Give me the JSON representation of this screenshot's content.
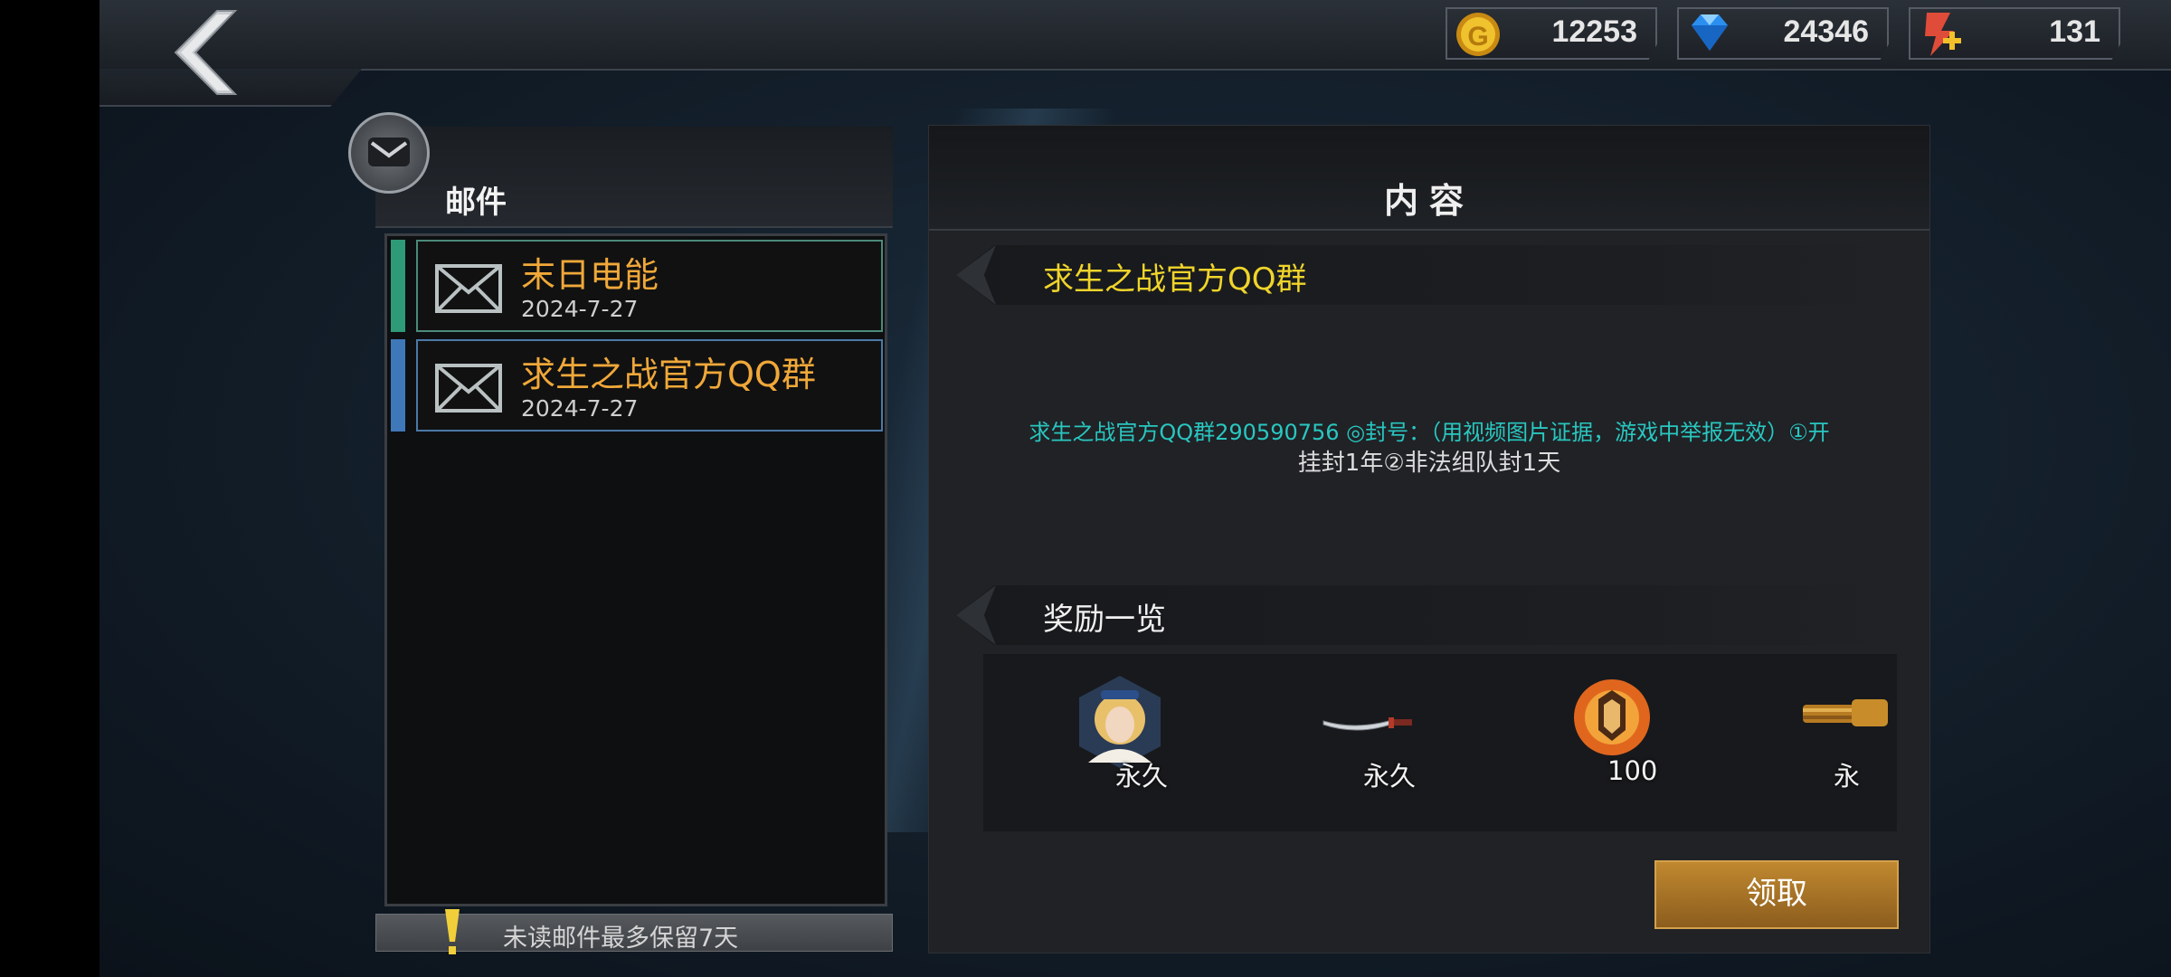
{
  "header": {
    "resources": [
      {
        "name": "gold",
        "value": "12253",
        "icon": "gold-coin-icon",
        "color": "#e9b422"
      },
      {
        "name": "diamond",
        "value": "24346",
        "icon": "diamond-icon",
        "color": "#2b8ff0"
      },
      {
        "name": "stamina",
        "value": "131",
        "icon": "stamina-plus-icon",
        "color": "#e04c3a"
      }
    ]
  },
  "mail": {
    "title": "邮件",
    "items": [
      {
        "subject": "末日电能",
        "date": "2024-7-27",
        "stripe_color": "#2f9a78"
      },
      {
        "subject": "求生之战官方QQ群",
        "date": "2024-7-27",
        "stripe_color": "#3f78b8"
      }
    ],
    "footer_text": "未读邮件最多保留7天"
  },
  "content": {
    "title": "内容",
    "mail_subject": "求生之战官方QQ群",
    "body_line1": "求生之战官方QQ群290590756 ◎封号：（用视频图片证据，游戏中举报无效）①开",
    "body_line2": "挂封1年②非法组队封1天",
    "rewards_title": "奖励一览",
    "rewards": [
      {
        "icon": "character-portrait-icon",
        "label": "永久"
      },
      {
        "icon": "katana-weapon-icon",
        "label": "永久"
      },
      {
        "icon": "flame-emblem-icon",
        "label": "100"
      },
      {
        "icon": "gatling-gun-icon",
        "label": "永"
      }
    ],
    "claim_label": "领取"
  }
}
